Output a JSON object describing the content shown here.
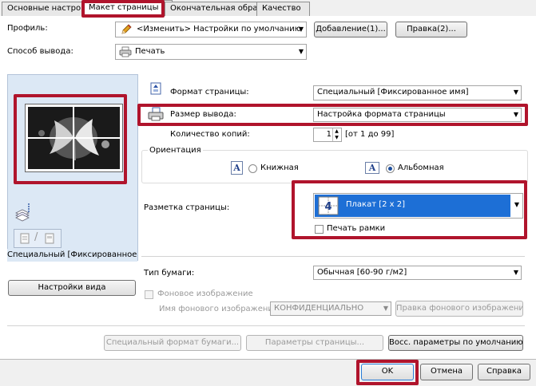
{
  "tabs": [
    "Основные настройки",
    "Макет страницы",
    "Окончательная обработка",
    "Качество"
  ],
  "profile": {
    "label": "Профиль:",
    "value": "<Изменить> Настройки по умолчанию",
    "add_button": "Добавление(1)...",
    "edit_button": "Правка(2)..."
  },
  "output_method": {
    "label": "Способ вывода:",
    "value": "Печать"
  },
  "preview": {
    "caption": "Специальный [Фиксированное им",
    "view_settings_button": "Настройки вида"
  },
  "page_format": {
    "label": "Формат страницы:",
    "value": "Специальный [Фиксированное имя]"
  },
  "output_size": {
    "label": "Размер вывода:",
    "value": "Настройка формата страницы"
  },
  "copies": {
    "label": "Количество копий:",
    "value": "1",
    "range": "[от 1 до 99]"
  },
  "orientation": {
    "title": "Ориентация",
    "portrait": "Книжная",
    "landscape": "Альбомная",
    "selected": "landscape"
  },
  "layout": {
    "label": "Разметка страницы:",
    "value": "Плакат [2 x 2]",
    "frame_label": "Печать рамки",
    "frame_checked": false
  },
  "paper_type": {
    "label": "Тип бумаги:",
    "value": "Обычная [60-90 г/м2]"
  },
  "watermark": {
    "checkbox_label": "Фоновое изображение",
    "name_label": "Имя фонового изображения:",
    "name_value": "КОНФИДЕНЦИАЛЬНО",
    "edit_button": "Правка фонового изображения..."
  },
  "bottom_buttons": {
    "custom_paper": "Специальный формат бумаги...",
    "page_options": "Параметры страницы...",
    "restore_defaults": "Восс. параметры по умолчанию"
  },
  "dialog_buttons": {
    "ok": "OK",
    "cancel": "Отмена",
    "help": "Справка"
  },
  "colors": {
    "highlight_red": "#b0142c",
    "selection_blue": "#1d6fd6",
    "preview_bg": "#dce8f5"
  },
  "icons": [
    "pencil-icon",
    "printer-icon",
    "page-format-icon",
    "output-size-icon",
    "orientation-portrait-icon",
    "orientation-landscape-icon",
    "poster-layout-icon",
    "paper-stack-icon"
  ]
}
